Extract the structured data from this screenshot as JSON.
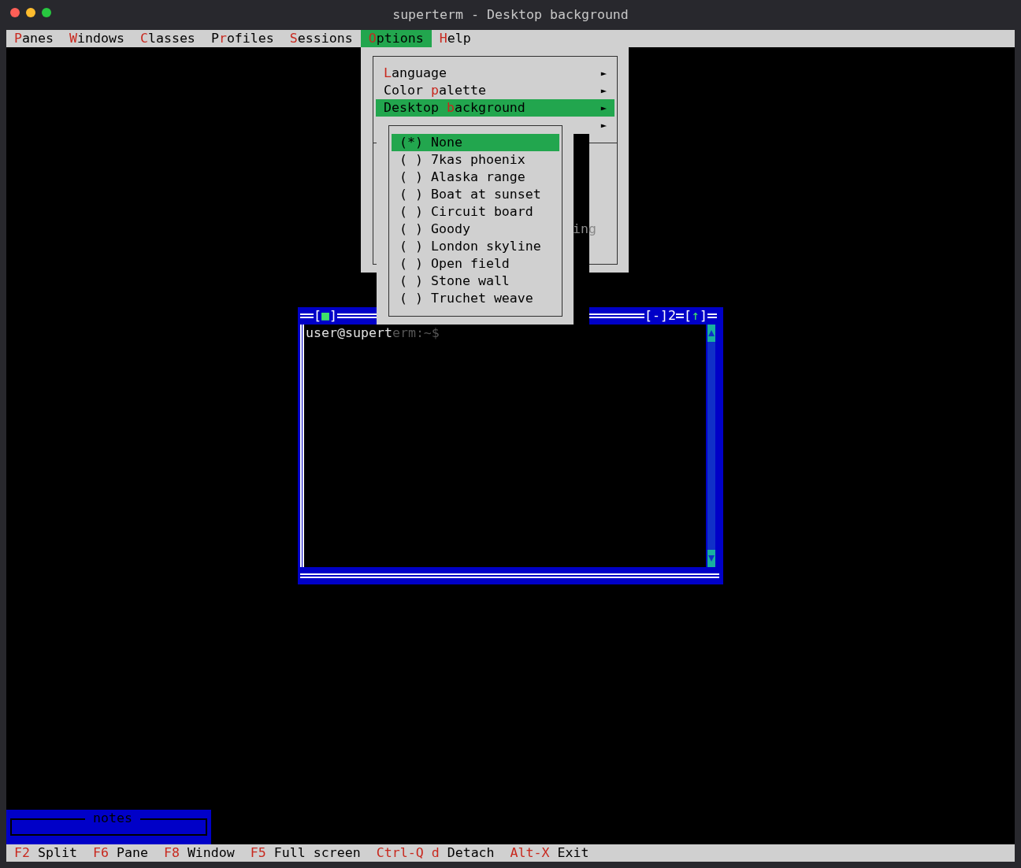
{
  "window": {
    "title": "superterm - Desktop background"
  },
  "menu_bar": [
    {
      "key": "P",
      "after": "anes",
      "selected": false
    },
    {
      "key": "W",
      "after": "indows",
      "selected": false
    },
    {
      "key": "C",
      "after": "lasses",
      "selected": false
    },
    {
      "before": "P",
      "key": "r",
      "after": "ofiles",
      "selected": false
    },
    {
      "key": "S",
      "after": "essions",
      "selected": false
    },
    {
      "key": "O",
      "after": "ptions",
      "selected": true
    },
    {
      "key": "H",
      "after": "elp",
      "selected": false
    }
  ],
  "options_menu": {
    "items": [
      {
        "key": "L",
        "after": "anguage",
        "arrow": "►",
        "selected": false
      },
      {
        "before": "Color ",
        "key": "p",
        "after": "alette",
        "arrow": "►",
        "selected": false
      },
      {
        "before": "Desktop ",
        "key": "b",
        "after": "ackground",
        "arrow": "►",
        "selected": true
      },
      {
        "arrow": "►",
        "selected": false
      }
    ],
    "obscured_item_text": "ing"
  },
  "background_submenu": {
    "items": [
      {
        "marker": "(*)",
        "label": "None",
        "selected": true
      },
      {
        "marker": "( )",
        "label": "7kas phoenix",
        "selected": false
      },
      {
        "marker": "( )",
        "label": "Alaska range",
        "selected": false
      },
      {
        "marker": "( )",
        "label": "Boat at sunset",
        "selected": false
      },
      {
        "marker": "( )",
        "label": "Circuit board",
        "selected": false
      },
      {
        "marker": "( )",
        "label": "Goody",
        "selected": false
      },
      {
        "marker": "( )",
        "label": "London skyline",
        "selected": false
      },
      {
        "marker": "( )",
        "label": "Open field",
        "selected": false
      },
      {
        "marker": "( )",
        "label": "Stone wall",
        "selected": false
      },
      {
        "marker": "( )",
        "label": "Truchet weave",
        "selected": false
      }
    ]
  },
  "terminal_window": {
    "close_button": {
      "left": "[",
      "glyph": "■",
      "right": "]"
    },
    "minimize_button": {
      "left": "[",
      "glyph": "-",
      "right": "]"
    },
    "number": "2",
    "maximize_button": {
      "left": "[",
      "glyph": "↑",
      "right": "]"
    },
    "prompt": "user@superterm:~$"
  },
  "notes_window": {
    "title": "notes"
  },
  "status_bar": [
    {
      "key": "F2",
      "label": "Split"
    },
    {
      "key": "F6",
      "label": "Pane"
    },
    {
      "key": "F8",
      "label": "Window"
    },
    {
      "key": "F5",
      "label": "Full screen"
    },
    {
      "key": "Ctrl-Q d",
      "label": "Detach"
    },
    {
      "key": "Alt-X",
      "label": "Exit"
    }
  ]
}
